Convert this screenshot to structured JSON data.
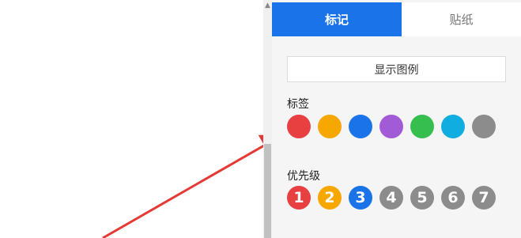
{
  "tabs": [
    {
      "label": "标记",
      "active": true
    },
    {
      "label": "贴纸",
      "active": false
    }
  ],
  "legend_button": "显示图例",
  "tag_section": {
    "title": "标签",
    "colors": [
      "#e84040",
      "#f7a800",
      "#1a73e8",
      "#a25bd6",
      "#36bf4f",
      "#10aee0",
      "#8c8c8c"
    ]
  },
  "priority_section": {
    "title": "优先级",
    "items": [
      {
        "label": "1",
        "color": "#e84040"
      },
      {
        "label": "2",
        "color": "#f7a800"
      },
      {
        "label": "3",
        "color": "#1a73e8"
      },
      {
        "label": "4",
        "color": "#8c8c8c"
      },
      {
        "label": "5",
        "color": "#8c8c8c"
      },
      {
        "label": "6",
        "color": "#8c8c8c"
      },
      {
        "label": "7",
        "color": "#8c8c8c"
      }
    ]
  },
  "annotation_color": "#e53935"
}
